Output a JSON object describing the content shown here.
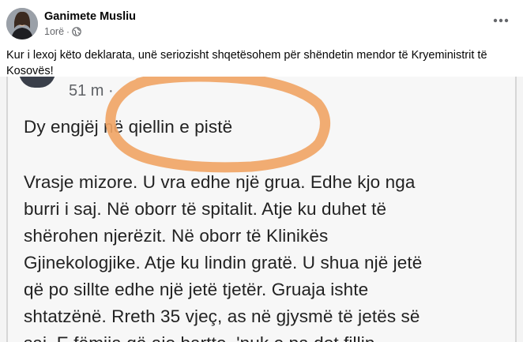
{
  "post": {
    "author": "Ganimete Musliu",
    "time": "1orë",
    "privacy_icon": "globe-icon",
    "menu_icon": "more-options-icon",
    "caption_line1": "Kur i lexoj këto deklarata, unë seriozisht shqetësohem për shëndetin mendor  të Kryeministrit të",
    "caption_line2": "Kosovës!"
  },
  "shared_screenshot": {
    "time": "51 m ·",
    "lines": [
      "Dy engjëj në qiellin e pistë",
      "Vrasje mizore. U vra edhe një grua. Edhe kjo nga",
      "burri i saj. Në oborr të spitalit. Atje ku duhet të",
      "shërohen njerëzit. Në oborr të Klinikës",
      "Gjinekologjike. Atje ku lindin gratë. U shua një jetë",
      "që po sillte edhe një jetë tjetër. Gruaja ishte",
      "shtatzënë. Rreth 35 vjeç, as në gjysmë të jetës së",
      "saj. E fëmija që ajo bartte, 'nuk e pa dot fillin"
    ],
    "highlight_color": "#f0a566"
  }
}
